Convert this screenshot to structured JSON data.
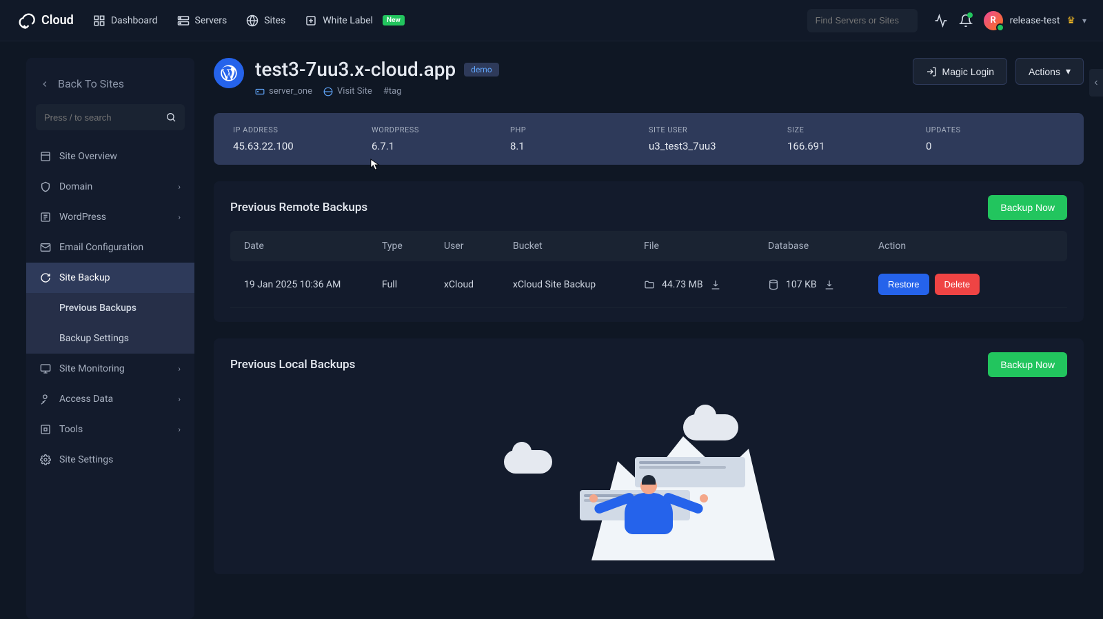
{
  "brand": "Cloud",
  "topnav": {
    "dashboard": "Dashboard",
    "servers": "Servers",
    "sites": "Sites",
    "whitelabel": "White Label",
    "new_badge": "New"
  },
  "search": {
    "placeholder": "Find Servers or Sites"
  },
  "user": {
    "name": "release-test",
    "initial": "R"
  },
  "sidebar": {
    "back": "Back To Sites",
    "search_placeholder": "Press / to search",
    "items": {
      "overview": "Site Overview",
      "domain": "Domain",
      "wordpress": "WordPress",
      "email": "Email Configuration",
      "backup": "Site Backup",
      "prev_backups": "Previous Backups",
      "backup_settings": "Backup Settings",
      "monitoring": "Site Monitoring",
      "access": "Access Data",
      "tools": "Tools",
      "settings": "Site Settings"
    }
  },
  "site": {
    "title": "test3-7uu3.x-cloud.app",
    "demo": "demo",
    "server": "server_one",
    "visit": "Visit Site",
    "tag": "#tag"
  },
  "actions": {
    "magic_login": "Magic Login",
    "actions": "Actions"
  },
  "stats": {
    "ip_label": "IP ADDRESS",
    "ip": "45.63.22.100",
    "wp_label": "WORDPRESS",
    "wp": "6.7.1",
    "php_label": "PHP",
    "php": "8.1",
    "user_label": "SITE USER",
    "user": "u3_test3_7uu3",
    "size_label": "SIZE",
    "size": "166.691",
    "updates_label": "UPDATES",
    "updates": "0"
  },
  "remote": {
    "title": "Previous Remote Backups",
    "backup_now": "Backup Now",
    "cols": {
      "date": "Date",
      "type": "Type",
      "user": "User",
      "bucket": "Bucket",
      "file": "File",
      "db": "Database",
      "action": "Action"
    },
    "row": {
      "date": "19 Jan 2025 10:36 AM",
      "type": "Full",
      "user": "xCloud",
      "bucket": "xCloud Site Backup",
      "file": "44.73 MB",
      "db": "107 KB",
      "restore": "Restore",
      "delete": "Delete"
    }
  },
  "local": {
    "title": "Previous Local Backups",
    "backup_now": "Backup Now"
  }
}
